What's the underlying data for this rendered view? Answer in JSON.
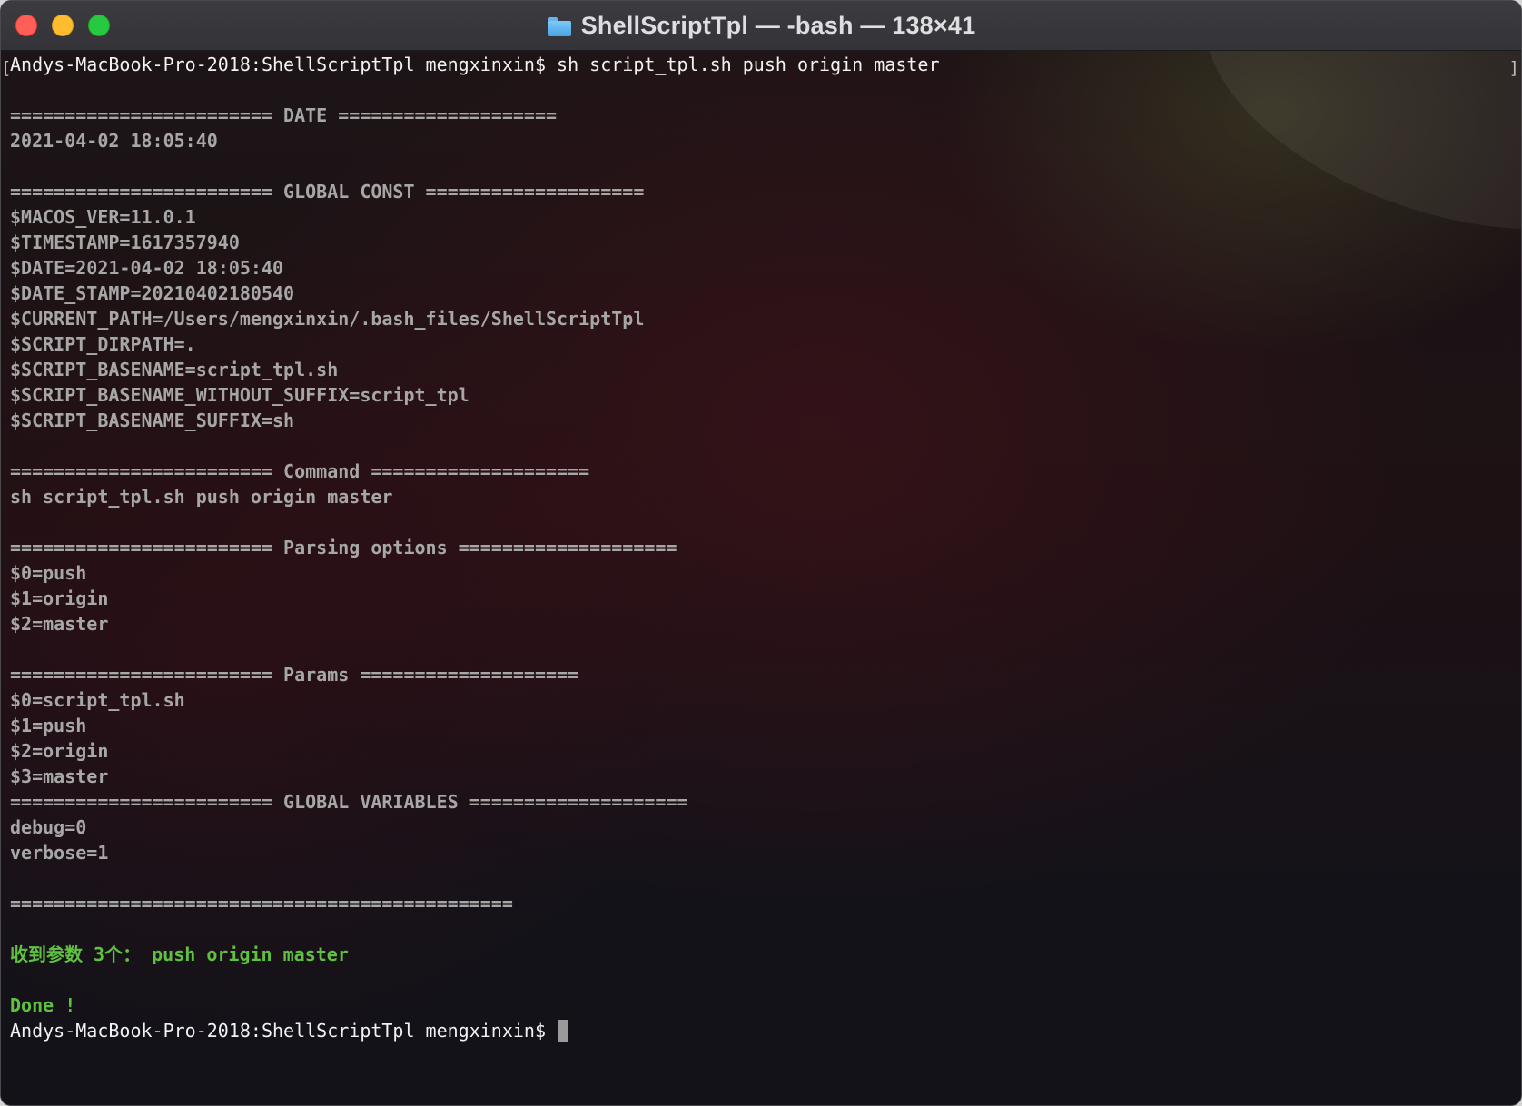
{
  "window": {
    "title": "ShellScriptTpl — -bash — 138×41"
  },
  "terminal": {
    "command_line": "Andys-MacBook-Pro-2018:ShellScriptTpl mengxinxin$ sh script_tpl.sh push origin master",
    "lines": [
      "",
      "======================== DATE ====================",
      "2021-04-02 18:05:40",
      "",
      "======================== GLOBAL CONST ====================",
      "$MACOS_VER=11.0.1",
      "$TIMESTAMP=1617357940",
      "$DATE=2021-04-02 18:05:40",
      "$DATE_STAMP=20210402180540",
      "$CURRENT_PATH=/Users/mengxinxin/.bash_files/ShellScriptTpl",
      "$SCRIPT_DIRPATH=.",
      "$SCRIPT_BASENAME=script_tpl.sh",
      "$SCRIPT_BASENAME_WITHOUT_SUFFIX=script_tpl",
      "$SCRIPT_BASENAME_SUFFIX=sh",
      "",
      "======================== Command ====================",
      "sh script_tpl.sh push origin master",
      "",
      "======================== Parsing options ====================",
      "$0=push",
      "$1=origin",
      "$2=master",
      "",
      "======================== Params ====================",
      "$0=script_tpl.sh",
      "$1=push",
      "$2=origin",
      "$3=master",
      "======================== GLOBAL VARIABLES ====================",
      "debug=0",
      "verbose=1",
      "",
      "=============================================="
    ],
    "blank_before_result": "",
    "result_line": "收到参数 3个： push origin master",
    "blank_before_done": "",
    "done_line": "Done !",
    "final_prompt": "Andys-MacBook-Pro-2018:ShellScriptTpl mengxinxin$ "
  },
  "colors": {
    "close": "#ff5f57",
    "minimize": "#febc2e",
    "zoom": "#28c840",
    "output_text": "#a7a7a7",
    "prompt_text": "#f2f2f2",
    "success_text": "#5fc13f"
  }
}
